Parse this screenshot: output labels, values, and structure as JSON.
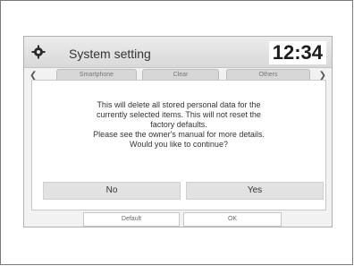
{
  "header": {
    "title": "System setting",
    "clock": "12:34"
  },
  "tabs": [
    {
      "label": "Smartphone"
    },
    {
      "label": "Clear"
    },
    {
      "label": "Others"
    }
  ],
  "dialog": {
    "message_lines": [
      "This will delete all stored personal data for the",
      "currently selected items. This will not reset the",
      "factory defaults.",
      "Please see the owner's manual for more details.",
      "Would you like to continue?"
    ],
    "no_label": "No",
    "yes_label": "Yes"
  },
  "bottom_buttons": {
    "default_label": "Default",
    "ok_label": "OK"
  },
  "icons": {
    "gear": "gear-icon",
    "left": "chevron-left-icon",
    "right": "chevron-right-icon"
  }
}
